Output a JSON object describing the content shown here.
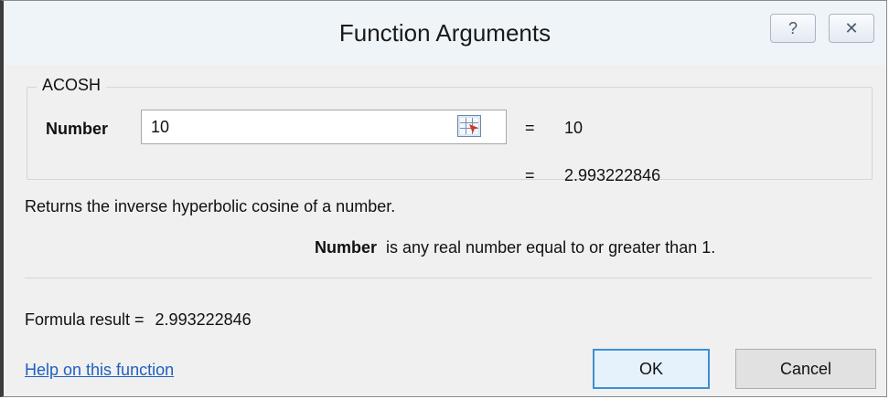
{
  "window": {
    "title": "Function Arguments",
    "help_symbol": "?",
    "close_symbol": "✕"
  },
  "group": {
    "function_name": "ACOSH",
    "argument": {
      "label": "Number",
      "value": "10",
      "equals": "=",
      "evaluated": "10"
    },
    "result_equals": "=",
    "result_value": "2.993222846"
  },
  "description": "Returns the inverse hyperbolic cosine of a number.",
  "param_help": {
    "name": "Number",
    "text": "is any real number equal to or greater than 1."
  },
  "formula_result": {
    "label": "Formula result =",
    "value": "2.993222846"
  },
  "footer": {
    "help_link": "Help on this function",
    "ok_label": "OK",
    "cancel_label": "Cancel"
  }
}
